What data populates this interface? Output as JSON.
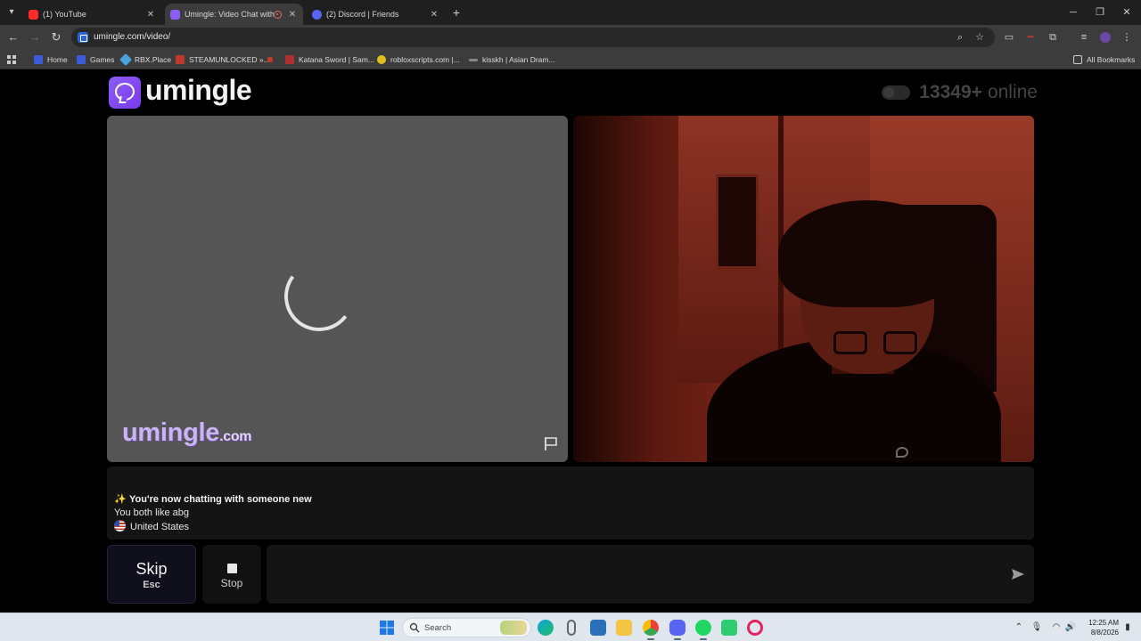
{
  "browser": {
    "tabs": [
      {
        "title": "(1) YouTube",
        "favicon_color": "#ff2a2a",
        "active": false
      },
      {
        "title": "Umingle: Video Chat with St",
        "favicon_color": "#8b5cf6",
        "active": true
      },
      {
        "title": "(2) Discord | Friends",
        "favicon_color": "#5865f2",
        "active": false
      }
    ],
    "url": "umingle.com/video/",
    "bookmarks": [
      {
        "label": "Home",
        "color": "#3b5bdb"
      },
      {
        "label": "Games",
        "color": "#3b5bdb"
      },
      {
        "label": "RBX.Place",
        "color": "#4aa3df"
      },
      {
        "label": "STEAMUNLOCKED »...",
        "color": "#c0392b"
      },
      {
        "label": "",
        "color": "#c0392b"
      },
      {
        "label": "Katana Sword | Sam...",
        "color": "#b03030"
      },
      {
        "label": "robloxscripts.com |...",
        "color": "#e0c020"
      },
      {
        "label": "kisskh | Asian Dram...",
        "color": "#888888"
      }
    ],
    "all_bookmarks_label": "All Bookmarks"
  },
  "site": {
    "logo_text": "umingle",
    "online_count": "13349+",
    "online_label": "online",
    "watermark": "umingle",
    "watermark_suffix": ".com",
    "accent": "#8b5cf6"
  },
  "chat": {
    "system_message": "You're now chatting with someone new",
    "interest_message": "You both like abg",
    "country": "United States",
    "input_value": "",
    "input_placeholder": ""
  },
  "controls": {
    "skip_label": "Skip",
    "skip_key": "Esc",
    "stop_label": "Stop"
  },
  "taskbar": {
    "search_label": "Search",
    "time": "12:25 AM",
    "date": "8/8/2026"
  }
}
